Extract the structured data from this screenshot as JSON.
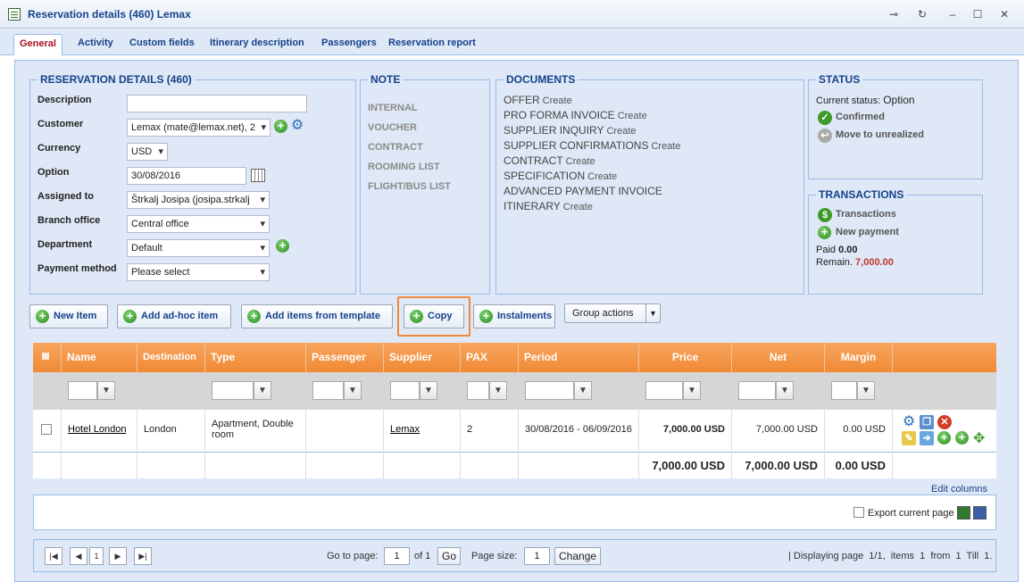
{
  "window": {
    "title": "Reservation details (460) Lemax"
  },
  "tabs": [
    {
      "label": "General"
    },
    {
      "label": "Activity"
    },
    {
      "label": "Custom fields"
    },
    {
      "label": "Itinerary description"
    },
    {
      "label": "Passengers"
    },
    {
      "label": "Reservation report"
    }
  ],
  "details": {
    "legend": "RESERVATION DETAILS (460)",
    "description_label": "Description",
    "description_value": "",
    "customer_label": "Customer",
    "customer_value": "Lemax (mate@lemax.net), 2",
    "currency_label": "Currency",
    "currency_value": "USD",
    "option_label": "Option",
    "option_value": "30/08/2016",
    "assigned_label": "Assigned to",
    "assigned_value": "Štrkalj Josipa (josipa.strkalj",
    "branch_label": "Branch office",
    "branch_value": "Central office",
    "department_label": "Department",
    "department_value": "Default",
    "payment_label": "Payment method",
    "payment_value": "Please select"
  },
  "note": {
    "legend": "NOTE",
    "items": [
      "INTERNAL",
      "VOUCHER",
      "CONTRACT",
      "ROOMING LIST",
      "FLIGHT/BUS LIST"
    ]
  },
  "documents": {
    "legend": "DOCUMENTS",
    "items": [
      {
        "label": "OFFER",
        "action": "Create"
      },
      {
        "label": "PRO FORMA INVOICE",
        "action": "Create"
      },
      {
        "label": "SUPPLIER INQUIRY",
        "action": "Create"
      },
      {
        "label": "SUPPLIER CONFIRMATIONS",
        "action": "Create"
      },
      {
        "label": "CONTRACT",
        "action": "Create"
      },
      {
        "label": "SPECIFICATION",
        "action": "Create"
      },
      {
        "label": "ADVANCED PAYMENT INVOICE",
        "action": ""
      },
      {
        "label": "ITINERARY",
        "action": "Create"
      }
    ]
  },
  "status": {
    "legend": "STATUS",
    "current_label": "Current status:",
    "current_value": "Option",
    "confirmed": "Confirmed",
    "unrealized": "Move to unrealized"
  },
  "transactions": {
    "legend": "TRANSACTIONS",
    "transactions_link": "Transactions",
    "new_payment": "New payment",
    "paid_label": "Paid",
    "paid_value": "0.00",
    "remain_label": "Remain.",
    "remain_value": "7,000.00",
    "remain_color": "#c0392b"
  },
  "toolbar": {
    "new_item": "New Item",
    "add_adhoc": "Add ad-hoc item",
    "add_template": "Add items from template",
    "copy": "Copy",
    "instalments": "Instalments",
    "group_actions": "Group actions",
    "highlight_color": "#f0883a"
  },
  "grid": {
    "columns": [
      "Name",
      "Destination",
      "Type",
      "Passenger",
      "Supplier",
      "PAX",
      "Period",
      "Price",
      "Net",
      "Margin"
    ],
    "row": {
      "name": "Hotel London",
      "destination": "London",
      "type": "Apartment, Double room",
      "passenger": "",
      "supplier": "Lemax",
      "pax": "2",
      "period": "30/08/2016 - 06/09/2016",
      "price": "7,000.00 USD",
      "net": "7,000.00 USD",
      "margin": "0.00 USD"
    },
    "totals": {
      "price": "7,000.00 USD",
      "net": "7,000.00 USD",
      "margin": "0.00 USD"
    },
    "header_color": "#f08a35"
  },
  "edit_columns": "Edit columns",
  "export_label": "Export current page",
  "pager": {
    "current_page": "1",
    "goto_label": "Go to page:",
    "goto_value": "1",
    "of_label": "of 1",
    "go_button": "Go",
    "size_label": "Page size:",
    "size_value": "1",
    "change_button": "Change",
    "summary": "| Displaying page  1/1,  items  1  from  1  Till  1."
  }
}
